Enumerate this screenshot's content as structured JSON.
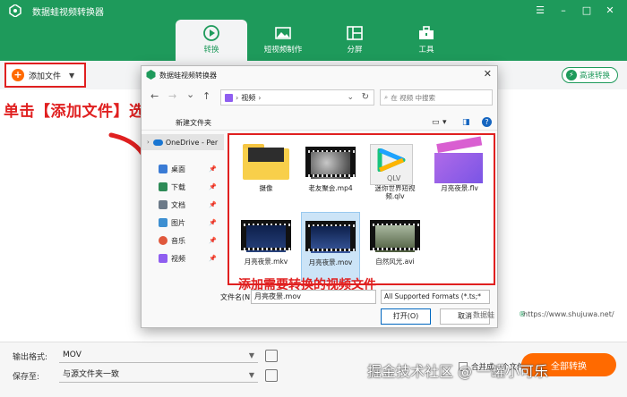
{
  "app": {
    "title": "数据蛙视频转换器",
    "window_controls": [
      "☰",
      "–",
      "□",
      "✕"
    ]
  },
  "nav_tabs": [
    {
      "label": "转换",
      "icon": "convert-icon",
      "active": true
    },
    {
      "label": "短视频制作",
      "icon": "image-icon",
      "active": false
    },
    {
      "label": "分屏",
      "icon": "split-screen-icon",
      "active": false
    },
    {
      "label": "工具",
      "icon": "toolbox-icon",
      "active": false
    }
  ],
  "toolbar": {
    "add_file_label": "添加文件",
    "add_file_icon": "+",
    "dropdown_arrow": "▼",
    "fast_convert_label": "高速转换",
    "fast_convert_icon": "⚡"
  },
  "annotations": {
    "select_option": "单击【添加文件】选项",
    "add_files": "添加需要转换的视频文件"
  },
  "dialog": {
    "title": "数据蛙视频转换器",
    "close": "✕",
    "nav_back": "←",
    "nav_forward": "→",
    "nav_down": "⌄",
    "nav_up": "↑",
    "address_folder": "视频",
    "address_sep": "›",
    "address_chevron": "⌄",
    "refresh": "↻",
    "search_placeholder": "在 视频 中搜索",
    "search_icon": "⌕",
    "new_folder": "新建文件夹",
    "view_icon": "▭",
    "view_caret": "▾",
    "pane_icon": "◨",
    "help": "?",
    "sidebar": [
      {
        "label": "OneDrive - Per",
        "icon": "cloud-icon",
        "color": "#1976d2"
      },
      {
        "label": "桌面",
        "icon": "desktop-icon",
        "color": "#3a7bd5"
      },
      {
        "label": "下载",
        "icon": "download-icon",
        "color": "#2e8b57"
      },
      {
        "label": "文档",
        "icon": "document-icon",
        "color": "#6c7a89"
      },
      {
        "label": "图片",
        "icon": "picture-icon",
        "color": "#3d8fd1"
      },
      {
        "label": "音乐",
        "icon": "music-icon",
        "color": "#e0583c"
      },
      {
        "label": "视频",
        "icon": "video-icon",
        "color": "#8f5ef0"
      }
    ],
    "sidebar_chevron": "›",
    "sidebar_pin": "📌",
    "files": [
      {
        "name": "摄像",
        "kind": "folder"
      },
      {
        "name": "老友聚会.mp4",
        "kind": "video"
      },
      {
        "name": "迷你世界短视频.qlv",
        "kind": "qlv"
      },
      {
        "name": "月亮夜景.flv",
        "kind": "clapper"
      },
      {
        "name": "月亮夜景.mkv",
        "kind": "video"
      },
      {
        "name": "月亮夜景.mov",
        "kind": "video",
        "selected": true
      },
      {
        "name": "自然风光.avi",
        "kind": "video"
      }
    ],
    "qlv_badge": "QLV",
    "filename_label": "文件名(N):",
    "filename_value": "月亮夜景.mov",
    "format_value": "All Supported Formats (*.ts;*",
    "open_button": "打开(O)",
    "cancel_button": "取消"
  },
  "bottom": {
    "output_format_label": "输出格式:",
    "output_format_value": "MOV",
    "save_to_label": "保存至:",
    "save_to_value": "与源文件夹一致",
    "dropdown_arrow": "▼",
    "merge_label": "合并成一个文件",
    "convert_all": "全部转换"
  },
  "watermarks": {
    "site": "数据蛙",
    "mark": "®",
    "url": "https://www.shujuwa.net/",
    "juejin": "掘金技术社区 @ 一罐小可乐"
  },
  "colors": {
    "brand_green": "#1e9a5b",
    "accent_orange": "#ff6a00",
    "annotation_red": "#e02020"
  }
}
